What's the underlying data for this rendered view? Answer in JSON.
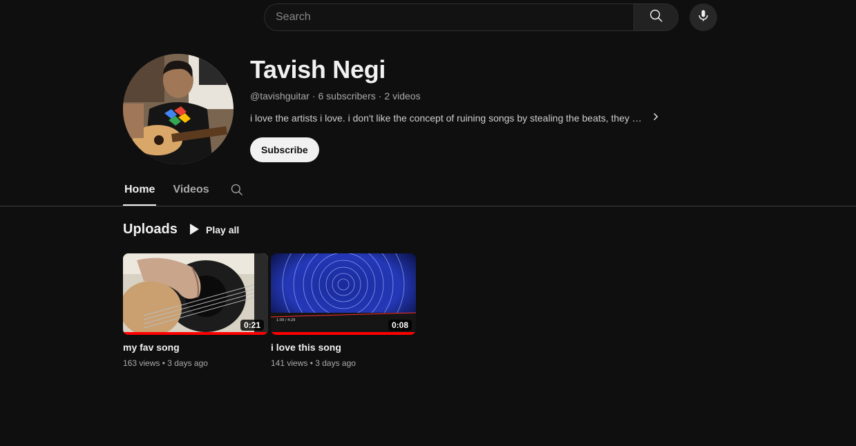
{
  "search": {
    "placeholder": "Search",
    "icon": "search-icon",
    "mic_icon": "microphone-icon"
  },
  "channel": {
    "name": "Tavish Negi",
    "handle": "@tavishguitar",
    "subscribers": "6 subscribers",
    "videos": "2 videos",
    "separator": "·",
    "description": "i love the artists i love. i don't like the concept of ruining songs by stealing the beats, they c...",
    "subscribe_label": "Subscribe"
  },
  "tabs": [
    {
      "label": "Home",
      "active": true
    },
    {
      "label": "Videos",
      "active": false
    }
  ],
  "uploads": {
    "title": "Uploads",
    "play_all_label": "Play all",
    "videos": [
      {
        "title": "my fav song",
        "duration": "0:21",
        "meta": "163 views • 3 days ago",
        "progress": 1.0
      },
      {
        "title": "i love this song",
        "duration": "0:08",
        "meta": "141 views • 3 days ago",
        "progress": 1.0
      }
    ]
  },
  "colors": {
    "background": "#0f0f0f",
    "text_primary": "#f1f1f1",
    "text_secondary": "#aaaaaa",
    "progress_red": "#ff0000"
  }
}
